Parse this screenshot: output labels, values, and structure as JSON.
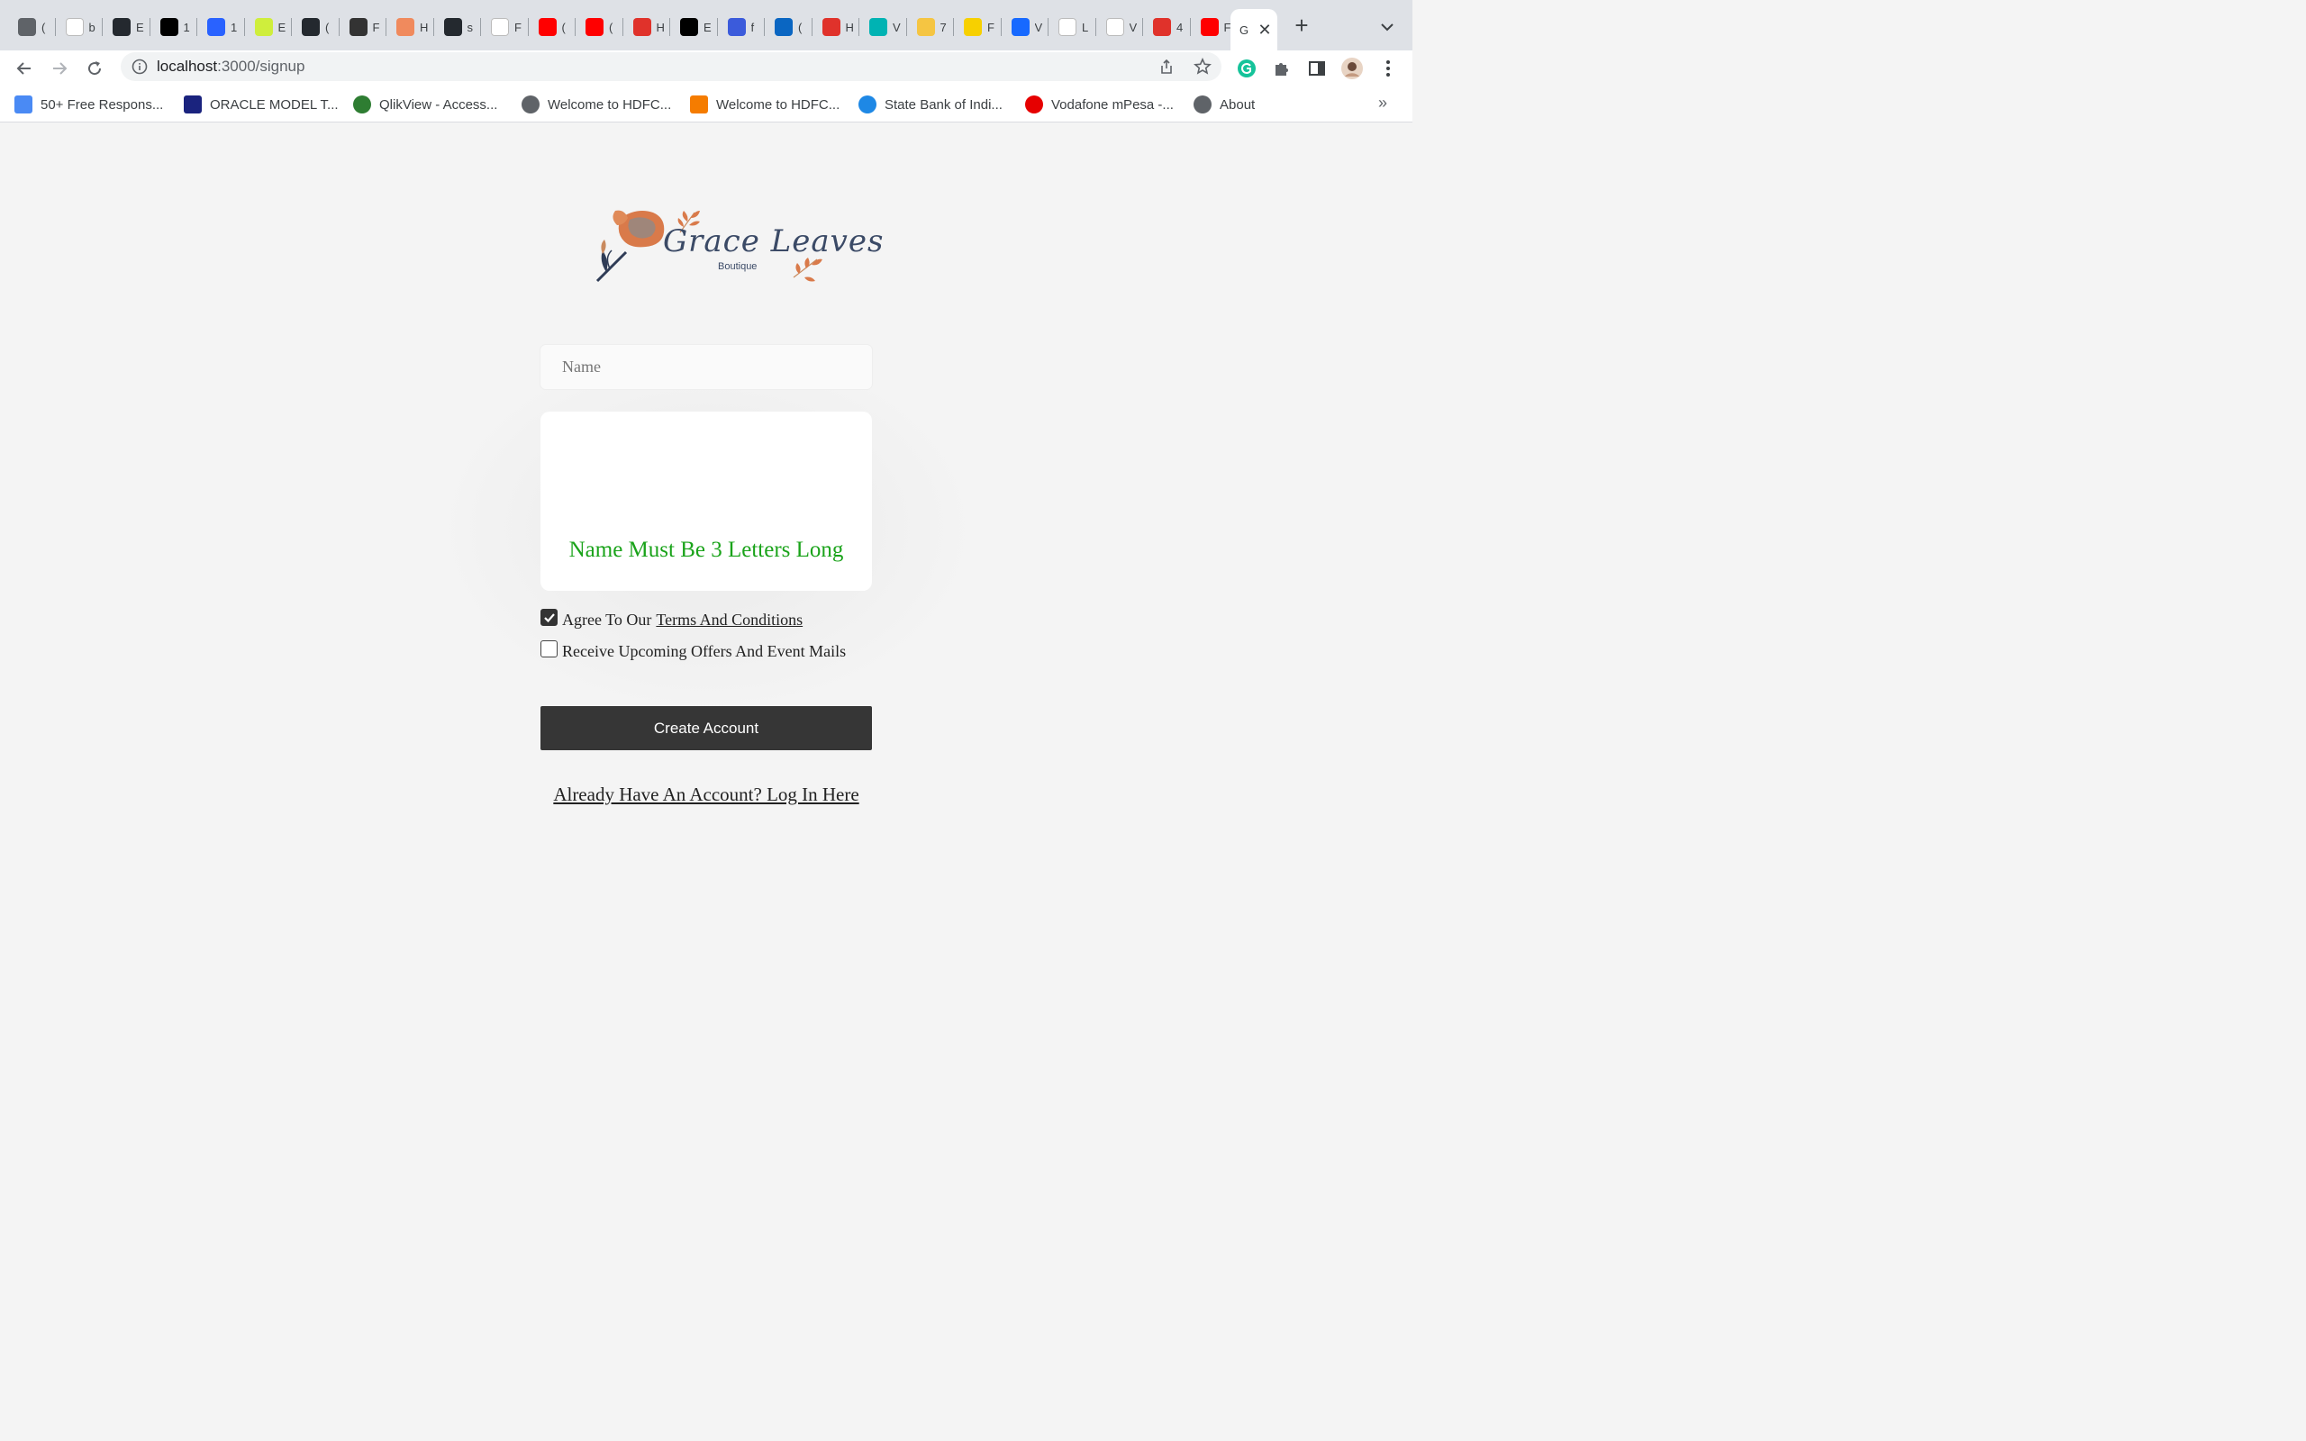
{
  "browser": {
    "tabs": [
      {
        "label": "(",
        "icon": "folder-icon",
        "color": "#5f6368"
      },
      {
        "label": "b",
        "icon": "google-icon",
        "color": "#ffffff"
      },
      {
        "label": "E",
        "icon": "github-icon",
        "color": "#24292f"
      },
      {
        "label": "1",
        "icon": "medium-icon",
        "color": "#000000"
      },
      {
        "label": "1",
        "icon": "hashnode-icon",
        "color": "#2962ff"
      },
      {
        "label": "E",
        "icon": "vercel-icon",
        "color": "#cfee3c"
      },
      {
        "label": "(",
        "icon": "github-icon",
        "color": "#24292f"
      },
      {
        "label": "F",
        "icon": "arc-icon",
        "color": "#333333"
      },
      {
        "label": "H",
        "icon": "pattern-icon",
        "color": "#f08a5d"
      },
      {
        "label": "s",
        "icon": "github-icon",
        "color": "#24292f"
      },
      {
        "label": "F",
        "icon": "bird-icon",
        "color": "#ffffff"
      },
      {
        "label": "(",
        "icon": "youtube-icon",
        "color": "#ff0000"
      },
      {
        "label": "(",
        "icon": "youtube-icon",
        "color": "#ff0000"
      },
      {
        "label": "H",
        "icon": "scribd-icon",
        "color": "#e0322b"
      },
      {
        "label": "E",
        "icon": "dev-icon",
        "color": "#000000"
      },
      {
        "label": "f",
        "icon": "dashboard-icon",
        "color": "#3b5bdb"
      },
      {
        "label": "(",
        "icon": "linkedin-icon",
        "color": "#0a66c2"
      },
      {
        "label": "H",
        "icon": "scribd-icon",
        "color": "#e0322b"
      },
      {
        "label": "V",
        "icon": "n-icon",
        "color": "#00b3b3"
      },
      {
        "label": "7",
        "icon": "coin-icon",
        "color": "#f5c542"
      },
      {
        "label": "F",
        "icon": "folder-yellow-icon",
        "color": "#f7d000"
      },
      {
        "label": "V",
        "icon": "behance-icon",
        "color": "#1769ff"
      },
      {
        "label": "L",
        "icon": "wix-icon",
        "color": "#ffffff"
      },
      {
        "label": "V",
        "icon": "wix-icon",
        "color": "#ffffff"
      },
      {
        "label": "4",
        "icon": "pen-icon",
        "color": "#e0322b"
      },
      {
        "label": "F",
        "icon": "youtube-icon",
        "color": "#ff0000"
      }
    ],
    "active_tab": {
      "label": "G",
      "icon": "page-icon"
    },
    "url_host": "localhost",
    "url_path": ":3000/signup",
    "bookmarks": [
      {
        "label": "50+ Free Respons...",
        "icon": "form-icon",
        "color": "#4a8af4"
      },
      {
        "label": "ORACLE MODEL T...",
        "icon": "p-icon",
        "color": "#1a237e"
      },
      {
        "label": "QlikView - Access...",
        "icon": "qlik-icon",
        "color": "#2e7d32"
      },
      {
        "label": "Welcome to HDFC...",
        "icon": "globe-icon",
        "color": "#5f6368"
      },
      {
        "label": "Welcome to HDFC...",
        "icon": "card-icon",
        "color": "#f57c00"
      },
      {
        "label": "State Bank of Indi...",
        "icon": "sbi-icon",
        "color": "#1e88e5"
      },
      {
        "label": "Vodafone mPesa -...",
        "icon": "vodafone-icon",
        "color": "#e60000"
      },
      {
        "label": "About",
        "icon": "globe-icon",
        "color": "#5f6368"
      }
    ]
  },
  "page": {
    "logo_title": "Grace Leaves",
    "logo_subtitle": "Boutique",
    "name_placeholder": "Name",
    "validation_message": "Name Must Be 3 Letters Long",
    "terms_prefix": "Agree To Our",
    "terms_link": "Terms And Conditions",
    "terms_checked": true,
    "offers_label": "Receive Upcoming Offers And Event Mails",
    "offers_checked": false,
    "create_button": "Create Account",
    "login_link": "Already Have An Account? Log In Here",
    "colors": {
      "message": "#1aa31a",
      "button": "#363636",
      "logo_ink": "#3b4a66",
      "logo_flower": "#d97a4a"
    }
  }
}
